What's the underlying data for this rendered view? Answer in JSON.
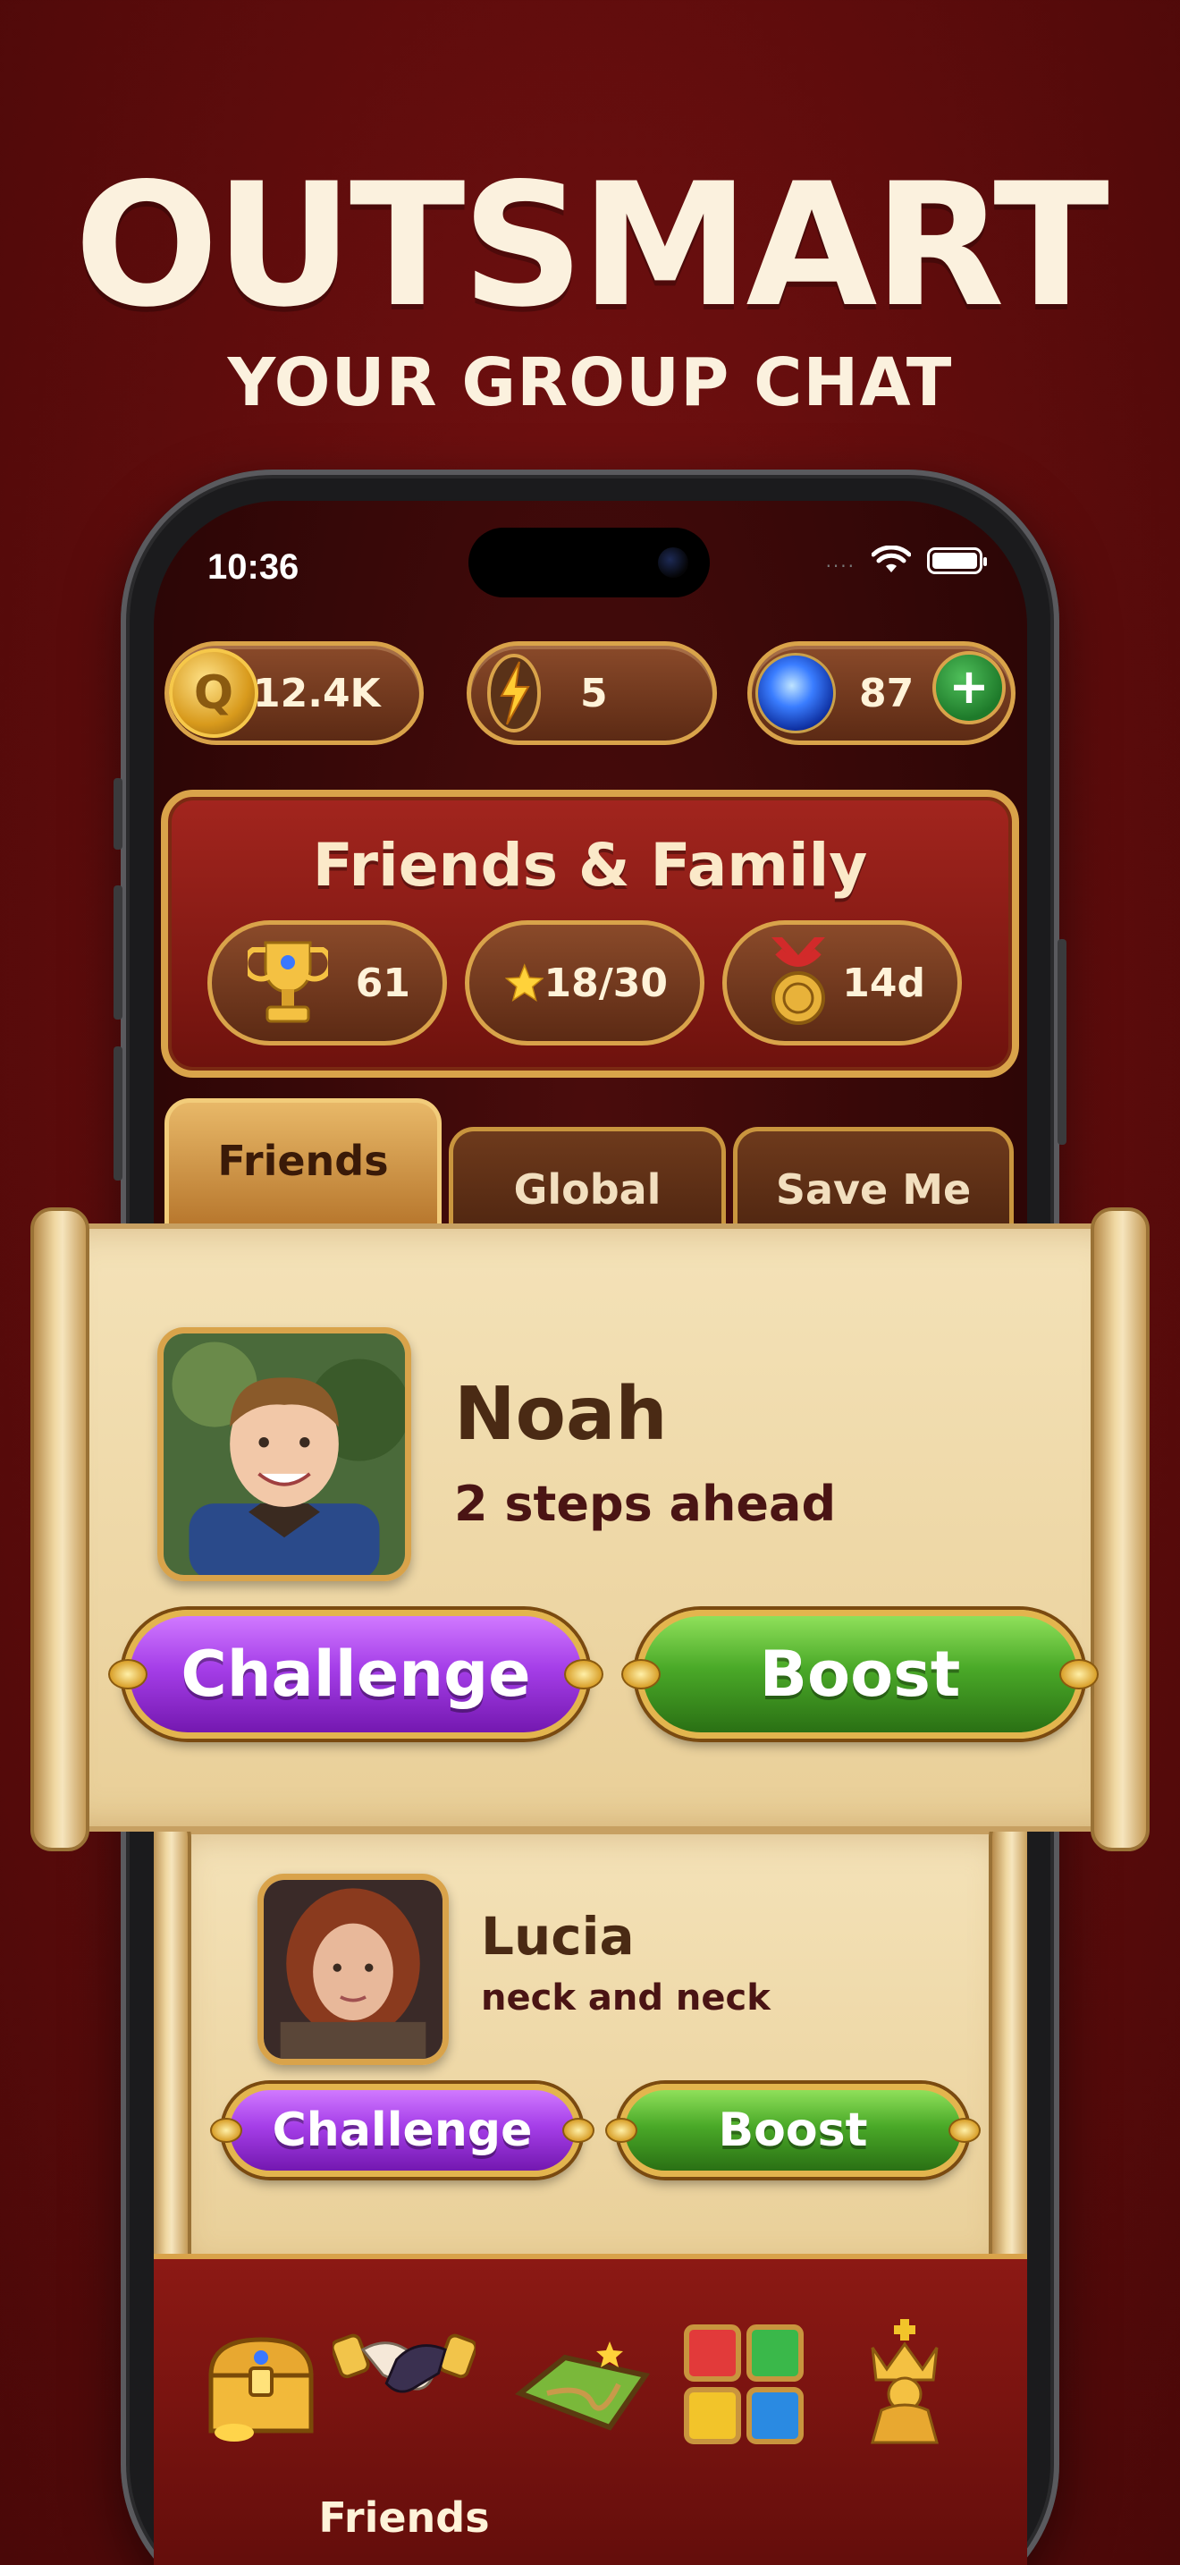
{
  "hero": {
    "title": "OUTSMART",
    "subtitle": "YOUR GROUP CHAT"
  },
  "status_bar": {
    "time": "10:36",
    "signal": "....",
    "icons": [
      "wifi-icon",
      "battery-icon"
    ]
  },
  "resources": {
    "coins": "12.4K",
    "coin_symbol": "Q",
    "energy": "5",
    "gems": "87",
    "add_label": "+"
  },
  "league": {
    "title": "Friends & Family",
    "trophies": "61",
    "stars": "18/30",
    "time_left": "14d"
  },
  "tabs": [
    {
      "label": "Friends",
      "active": true
    },
    {
      "label": "Global",
      "active": false
    },
    {
      "label": "Save Me",
      "active": false
    }
  ],
  "friends": [
    {
      "name": "Noah",
      "status": "2 steps ahead",
      "challenge_label": "Challenge",
      "boost_label": "Boost"
    },
    {
      "name": "Lucia",
      "status": "neck and neck",
      "challenge_label": "Challenge",
      "boost_label": "Boost"
    }
  ],
  "nav": {
    "items": [
      "treasure-chest-icon",
      "handshake-icon",
      "map-icon",
      "grid-icon",
      "king-icon"
    ],
    "active_label": "Friends"
  },
  "colors": {
    "background": "#5e0c0c",
    "gold": "#d9a34a",
    "purple_button": "#a53ee8",
    "green_button": "#4aa928",
    "parchment": "#f4e2b8"
  }
}
